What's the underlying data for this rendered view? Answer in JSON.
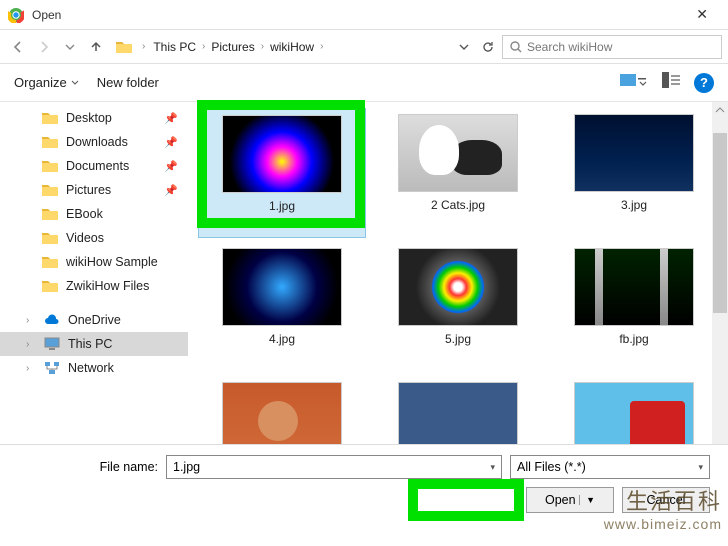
{
  "title": "Open",
  "breadcrumbs": [
    "This PC",
    "Pictures",
    "wikiHow"
  ],
  "search": {
    "placeholder": "Search wikiHow"
  },
  "toolbar": {
    "organize": "Organize",
    "newfolder": "New folder"
  },
  "sidebar": {
    "quick": [
      {
        "label": "Desktop",
        "pinned": true
      },
      {
        "label": "Downloads",
        "pinned": true
      },
      {
        "label": "Documents",
        "pinned": true
      },
      {
        "label": "Pictures",
        "pinned": true
      },
      {
        "label": "EBook",
        "pinned": false
      },
      {
        "label": "Videos",
        "pinned": false
      },
      {
        "label": "wikiHow Sample",
        "pinned": false
      },
      {
        "label": "ZwikiHow Files",
        "pinned": false
      }
    ],
    "groups": [
      {
        "label": "OneDrive",
        "icon": "cloud"
      },
      {
        "label": "This PC",
        "icon": "pc",
        "selected": true
      },
      {
        "label": "Network",
        "icon": "network"
      }
    ]
  },
  "files": [
    {
      "label": "1.jpg",
      "selected": true,
      "thumb": "t1"
    },
    {
      "label": "2 Cats.jpg",
      "thumb": "t2"
    },
    {
      "label": "3.jpg",
      "thumb": "t3"
    },
    {
      "label": "4.jpg",
      "thumb": "t4"
    },
    {
      "label": "5.jpg",
      "thumb": "t5"
    },
    {
      "label": "fb.jpg",
      "thumb": "t6"
    },
    {
      "label": "",
      "thumb": "t7"
    },
    {
      "label": "",
      "thumb": "t8"
    },
    {
      "label": "",
      "thumb": "t9"
    }
  ],
  "bottom": {
    "filename_label": "File name:",
    "filename_value": "1.jpg",
    "filter_value": "All Files (*.*)",
    "open": "Open",
    "cancel": "Cancel"
  },
  "watermark": {
    "top": "生活百科",
    "bot": "www.bimeiz.com"
  }
}
